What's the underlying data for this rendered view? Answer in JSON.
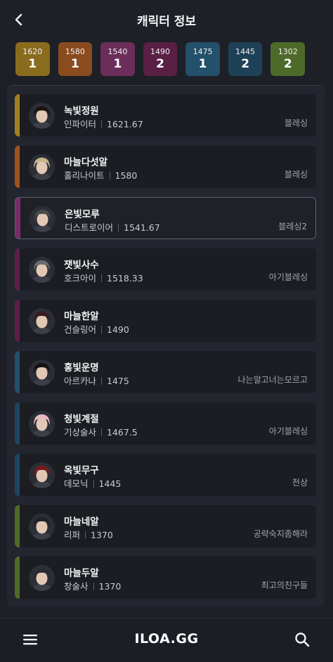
{
  "header": {
    "title": "캐릭터 정보"
  },
  "tiers": [
    {
      "level": "1620",
      "count": "1",
      "color": "#8a6c1e"
    },
    {
      "level": "1580",
      "count": "1",
      "color": "#8a4b1f"
    },
    {
      "level": "1540",
      "count": "1",
      "color": "#6b2e5a"
    },
    {
      "level": "1490",
      "count": "2",
      "color": "#5a1f44"
    },
    {
      "level": "1475",
      "count": "1",
      "color": "#23506a"
    },
    {
      "level": "1445",
      "count": "2",
      "color": "#1f4158"
    },
    {
      "level": "1302",
      "count": "2",
      "color": "#4e6a2a"
    }
  ],
  "characters": [
    {
      "name": "녹빛정원",
      "class": "인파이터",
      "item_level": "1621.67",
      "guild": "블레싱",
      "color": "#a3801f",
      "selected": false
    },
    {
      "name": "마늘다섯알",
      "class": "홀리나이트",
      "item_level": "1580",
      "guild": "블레싱",
      "color": "#a0541d",
      "selected": false
    },
    {
      "name": "은빛모루",
      "class": "디스트로이어",
      "item_level": "1541.67",
      "guild": "블레싱2",
      "color": "#7a2c68",
      "selected": true
    },
    {
      "name": "잿빛사수",
      "class": "호크아이",
      "item_level": "1518.33",
      "guild": "아기블레싱",
      "color": "#5e1e48",
      "selected": false
    },
    {
      "name": "마늘한알",
      "class": "건슬링어",
      "item_level": "1490",
      "guild": "",
      "color": "#5e1e48",
      "selected": false
    },
    {
      "name": "홍빛운명",
      "class": "아르카나",
      "item_level": "1475",
      "guild": "나는알고너는모르고",
      "color": "#22506d",
      "selected": false
    },
    {
      "name": "청빛계절",
      "class": "기상술사",
      "item_level": "1467.5",
      "guild": "아기블레싱",
      "color": "#1c4660",
      "selected": false
    },
    {
      "name": "옥빛무구",
      "class": "데모닉",
      "item_level": "1445",
      "guild": "천상",
      "color": "#1c4660",
      "selected": false
    },
    {
      "name": "마늘네알",
      "class": "리퍼",
      "item_level": "1370",
      "guild": "공략숙지좀해라",
      "color": "#4f6b26",
      "selected": false
    },
    {
      "name": "마늘두알",
      "class": "창술사",
      "item_level": "1370",
      "guild": "최고의친구들",
      "color": "#4f6b26",
      "selected": false
    }
  ],
  "footer": {
    "logo": "ILOA.GG"
  },
  "icons": {
    "back": "back-arrow-icon",
    "menu": "hamburger-menu-icon",
    "search": "search-icon"
  }
}
